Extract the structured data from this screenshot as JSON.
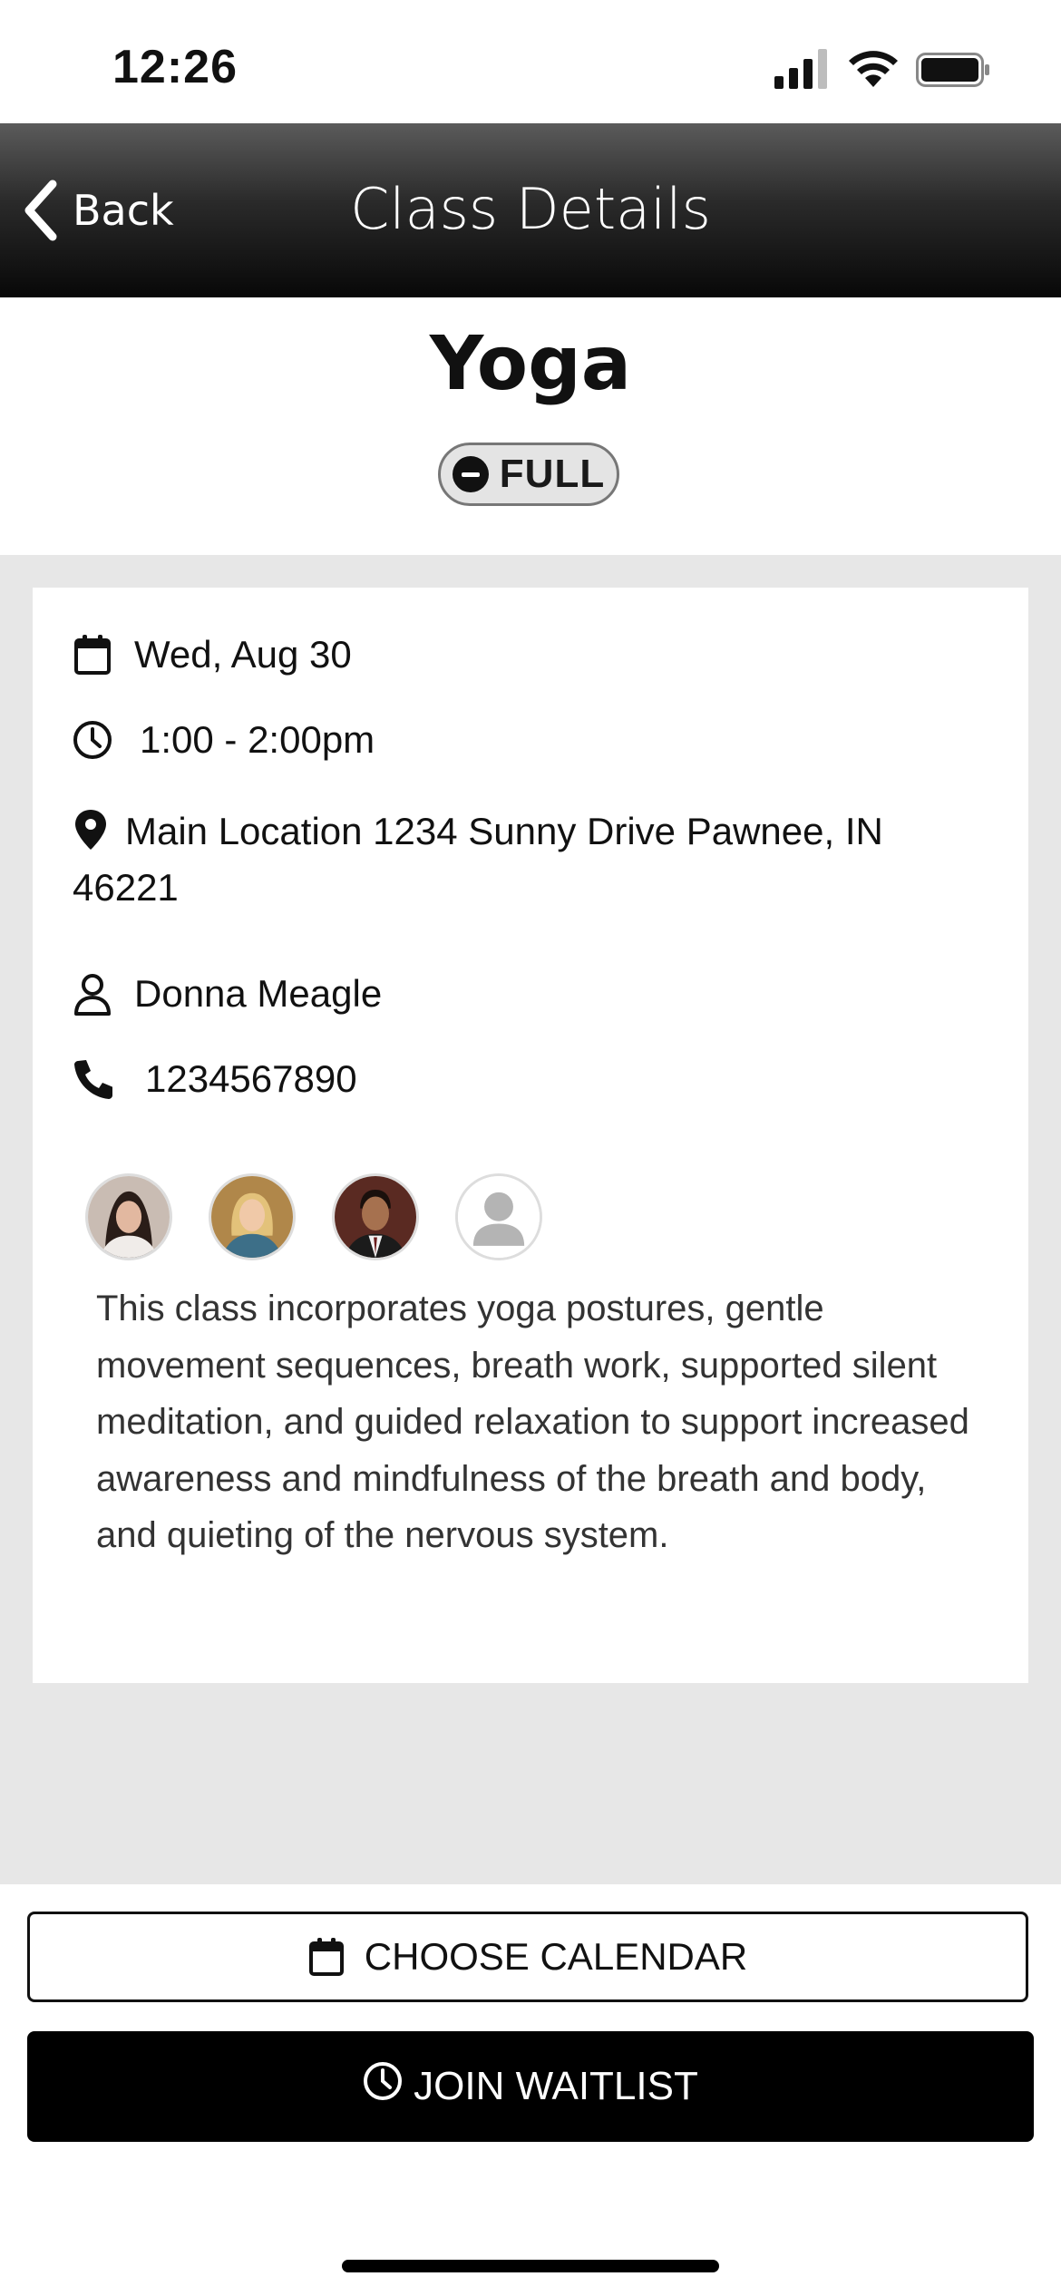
{
  "status_bar": {
    "time": "12:26"
  },
  "nav": {
    "back_label": "Back",
    "title": "Class Details"
  },
  "class": {
    "title": "Yoga",
    "status": "FULL"
  },
  "details": {
    "date": "Wed, Aug 30",
    "time": "1:00 - 2:00pm",
    "location": "Main Location 1234 Sunny Drive Pawnee, IN 46221",
    "instructor": "Donna Meagle",
    "phone": "1234567890"
  },
  "attendees": [
    "attendee-1",
    "attendee-2",
    "attendee-3",
    "attendee-placeholder"
  ],
  "description": "This class incorporates yoga postures, gentle movement sequences, breath work, supported silent meditation, and guided relaxation to support increased awareness and mindfulness of the breath and body, and quieting of the nervous system.",
  "buttons": {
    "calendar": "CHOOSE CALENDAR",
    "waitlist": "JOIN WAITLIST"
  },
  "colors": {
    "nav_bg": "#1c1c1c",
    "content_bg": "#e7e7e7",
    "primary_button": "#000000"
  }
}
